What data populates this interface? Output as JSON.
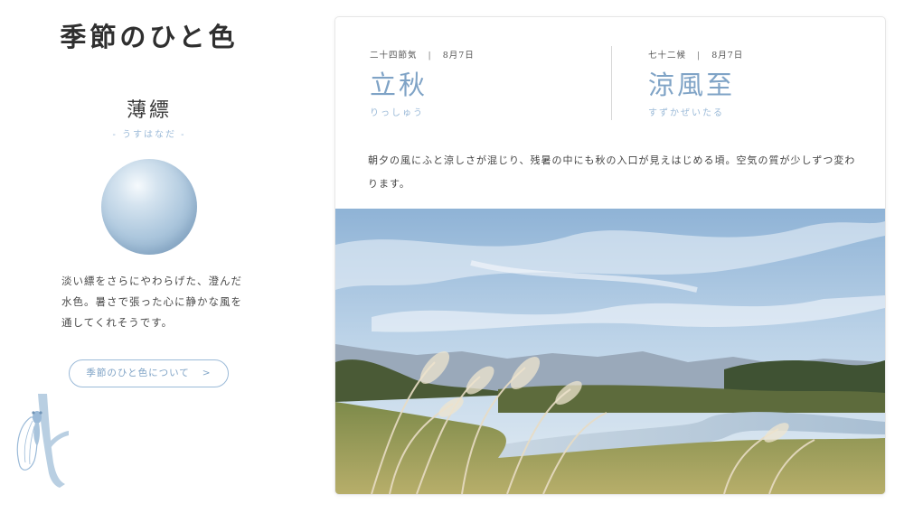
{
  "site": {
    "title": "季節のひと色"
  },
  "color": {
    "name": "薄縹",
    "reading": "- うすはなだ -",
    "description": "淡い縹をさらにやわらげた、澄んだ水色。暑さで張った心に静かな風を通してくれそうです。",
    "swatch_hex": "#aec8de"
  },
  "about_button": {
    "label": "季節のひと色について",
    "arrow": ">"
  },
  "sekki": {
    "category": "二十四節気",
    "date": "8月7日",
    "name": "立秋",
    "reading": "りっしゅう"
  },
  "kou": {
    "category": "七十二候",
    "date": "8月7日",
    "name": "涼風至",
    "reading": "すずかぜいたる"
  },
  "season_description": "朝夕の風にふと涼しさが混じり、残暑の中にも秋の入口が見えはじめる頃。空気の質が少しずつ変わります。",
  "separator": "|",
  "accent_color": "#7fa3c6",
  "icons": {
    "decoration": "cicada-icon"
  }
}
